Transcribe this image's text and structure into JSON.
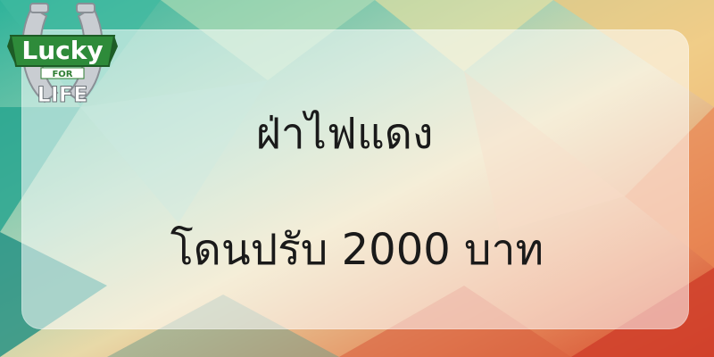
{
  "logo": {
    "word_top": "Lucky",
    "word_mid": "FOR",
    "word_bottom": "LIFE",
    "colors": {
      "banner": "#2e8b3a",
      "banner_dark": "#1d5c26",
      "horseshoe": "#c9cdd2",
      "text_light": "#ffffff",
      "text_dark": "#2e7d32"
    }
  },
  "content": {
    "line1": "ฝ่าไฟแดง",
    "line2": "โดนปรับ 2000 บาท"
  },
  "colors": {
    "card_overlay": "rgba(255,255,255,0.55)",
    "text": "#1a1a1a"
  }
}
